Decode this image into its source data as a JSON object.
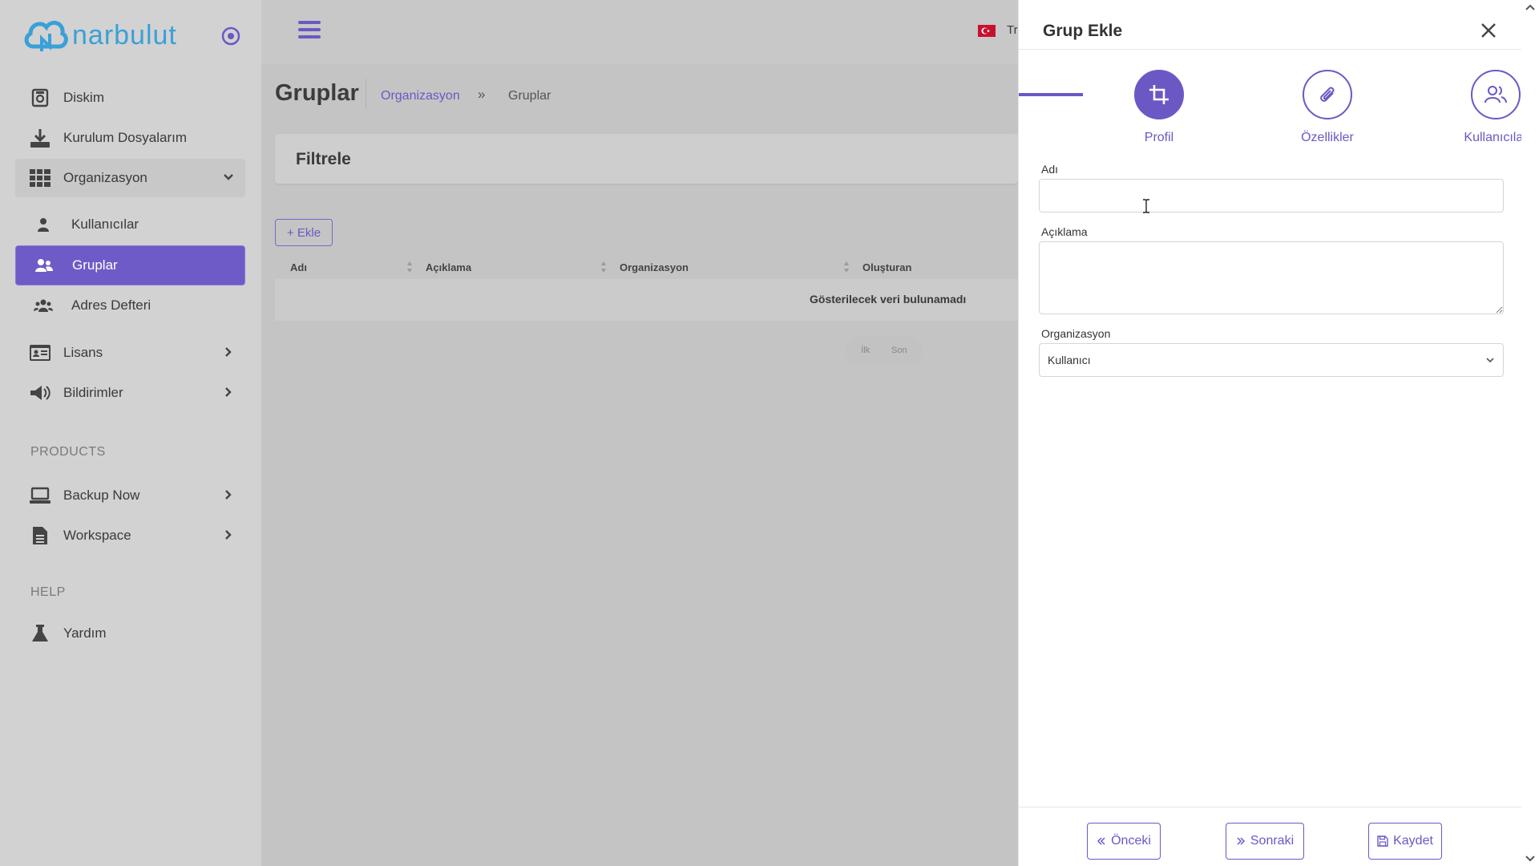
{
  "logo": {
    "text": "narbulut",
    "color": "#3aa0d8"
  },
  "sidebar": {
    "items": [
      {
        "label": "Diskim",
        "icon": "disk-icon"
      },
      {
        "label": "Kurulum Dosyalarım",
        "icon": "download-icon"
      },
      {
        "label": "Organizasyon",
        "icon": "grid-icon",
        "expanded": true
      },
      {
        "label": "Kullanıcılar",
        "icon": "user-icon"
      },
      {
        "label": "Gruplar",
        "icon": "users-icon",
        "active": true
      },
      {
        "label": "Adres Defteri",
        "icon": "address-book-icon"
      },
      {
        "label": "Lisans",
        "icon": "id-card-icon"
      },
      {
        "label": "Bildirimler",
        "icon": "megaphone-icon"
      }
    ],
    "products_section": "PRODUCTS",
    "products": [
      {
        "label": "Backup Now",
        "icon": "laptop-icon"
      },
      {
        "label": "Workspace",
        "icon": "document-icon"
      }
    ],
    "help_section": "HELP",
    "help": [
      {
        "label": "Yardım",
        "icon": "flask-icon"
      }
    ]
  },
  "header": {
    "language": "Tr"
  },
  "page": {
    "title": "Gruplar",
    "breadcrumb": {
      "parent": "Organizasyon",
      "separator": "»",
      "current": "Gruplar"
    },
    "filter_title": "Filtrele",
    "add_button": "+ Ekle",
    "table": {
      "columns": [
        "Adı",
        "Açıklama",
        "Organizasyon",
        "Oluşturan"
      ],
      "empty_message": "Gösterilecek veri bulunamadı"
    },
    "pager": {
      "first": "İlk",
      "last": "Son"
    }
  },
  "drawer": {
    "title": "Grup Ekle",
    "steps": [
      {
        "label": "Profil",
        "icon": "crop-icon",
        "active": true
      },
      {
        "label": "Özellikler",
        "icon": "paperclip-icon",
        "active": false
      },
      {
        "label": "Kullanıcılar",
        "icon": "users-outline-icon",
        "active": false
      }
    ],
    "form": {
      "name_label": "Adı",
      "name_value": "",
      "description_label": "Açıklama",
      "description_value": "",
      "organization_label": "Organizasyon",
      "organization_value": "Kullanıcı"
    },
    "buttons": {
      "prev": "Önceki",
      "next": "Sonraki",
      "save": "Kaydet"
    }
  },
  "colors": {
    "accent": "#6b58c4",
    "overlay": "#c4c4c4"
  }
}
